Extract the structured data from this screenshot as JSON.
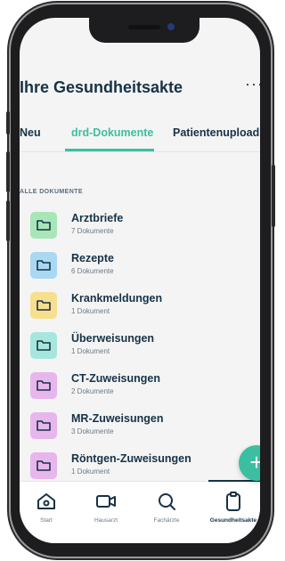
{
  "header": {
    "title": "Ihre Gesundheitsakte",
    "more_label": "···"
  },
  "tabs": [
    {
      "label": "Neu"
    },
    {
      "label": "drd-Dokumente",
      "active": true
    },
    {
      "label": "Patientenuploads"
    }
  ],
  "section": {
    "label": "ALLE DOKUMENTE"
  },
  "documents": [
    {
      "title": "Arztbriefe",
      "count": "7 Dokumente",
      "color": "#a8e6b8"
    },
    {
      "title": "Rezepte",
      "count": "6 Dokumente",
      "color": "#a9d8f2"
    },
    {
      "title": "Krankmeldungen",
      "count": "1 Dokument",
      "color": "#f7df8e"
    },
    {
      "title": "Überweisungen",
      "count": "1 Dokument",
      "color": "#a7e6dc"
    },
    {
      "title": "CT-Zuweisungen",
      "count": "2 Dokumente",
      "color": "#e7b6ec"
    },
    {
      "title": "MR-Zuweisungen",
      "count": "3 Dokumente",
      "color": "#e7b6ec"
    },
    {
      "title": "Röntgen-Zuweisungen",
      "count": "1 Dokument",
      "color": "#e7b6ec"
    }
  ],
  "fab": {
    "label": "+"
  },
  "bottom_nav": [
    {
      "label": "Start",
      "icon": "home-icon"
    },
    {
      "label": "Hausarzt",
      "icon": "video-icon"
    },
    {
      "label": "Fachärzte",
      "icon": "search-icon"
    },
    {
      "label": "Gesundheitsakte",
      "icon": "clipboard-icon",
      "active": true
    }
  ],
  "colors": {
    "accent": "#3bbfa0",
    "text_dark": "#163247",
    "muted": "#6b7a86"
  }
}
